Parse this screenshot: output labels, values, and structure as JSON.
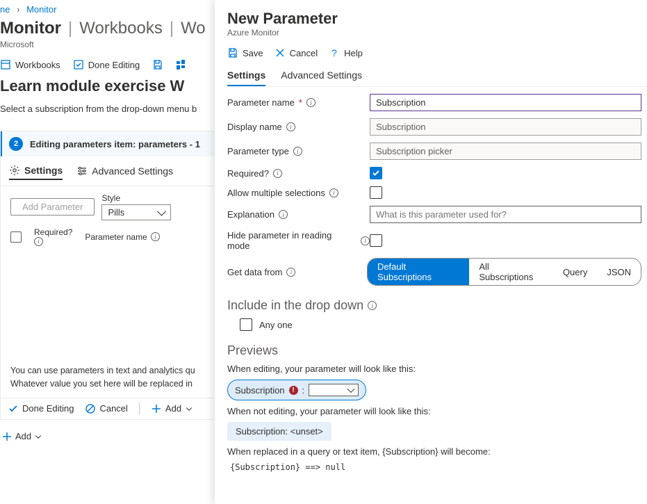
{
  "breadcrumb": {
    "item1": "ne",
    "item2": "Monitor"
  },
  "header": {
    "title_main": "Monitor",
    "title_sub1": "Workbooks",
    "title_sub2": "Wo",
    "subtitle": "Microsoft"
  },
  "toolbar": {
    "workbooks": "Workbooks",
    "done_editing": "Done Editing"
  },
  "exercise": {
    "title": "Learn module exercise W",
    "instruction": "Select a subscription from the drop-down menu b"
  },
  "card": {
    "step_number": "2",
    "header": "Editing parameters item: parameters - 1",
    "tab_settings": "Settings",
    "tab_advanced": "Advanced Settings",
    "style_label": "Style",
    "style_value": "Pills",
    "add_parameter": "Add Parameter",
    "col_required": "Required?",
    "col_param_name": "Parameter name",
    "hint1": "You can use parameters in text and analytics qu",
    "hint2": "Whatever value you set here will be replaced in",
    "footer": {
      "done_editing": "Done Editing",
      "cancel": "Cancel",
      "add": "Add"
    }
  },
  "add_global": "Add",
  "panel": {
    "title": "New Parameter",
    "subtitle": "Azure Monitor",
    "toolbar": {
      "save": "Save",
      "cancel": "Cancel",
      "help": "Help"
    },
    "tabs": {
      "settings": "Settings",
      "advanced": "Advanced Settings"
    },
    "fields": {
      "param_name_label": "Parameter name",
      "param_name_value": "Subscription",
      "display_name_label": "Display name",
      "display_name_value": "Subscription",
      "param_type_label": "Parameter type",
      "param_type_value": "Subscription picker",
      "required_label": "Required?",
      "allow_multi_label": "Allow multiple selections",
      "explanation_label": "Explanation",
      "explanation_placeholder": "What is this parameter used for?",
      "hide_label": "Hide parameter in reading mode",
      "get_data_label": "Get data from",
      "pills": {
        "default": "Default Subscriptions",
        "all": "All Subscriptions",
        "query": "Query",
        "json": "JSON"
      }
    },
    "include": {
      "heading": "Include in the drop down",
      "any_one": "Any one"
    },
    "previews": {
      "heading": "Previews",
      "editing_desc": "When editing, your parameter will look like this:",
      "editing_label": "Subscription",
      "not_editing_desc": "When not editing, your parameter will look like this:",
      "not_editing_pill": "Subscription: <unset>",
      "replace_desc": "When replaced in a query or text item, {Subscription} will become:",
      "replace_code": "{Subscription} ==> null"
    }
  }
}
